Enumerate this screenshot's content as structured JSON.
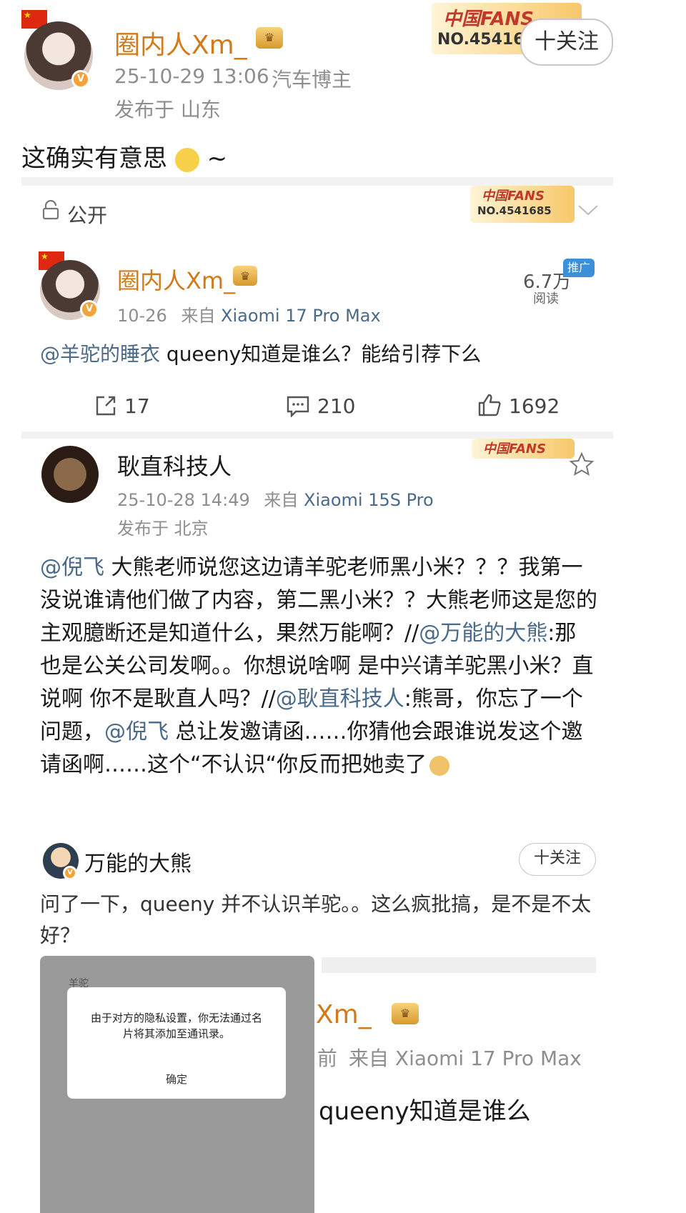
{
  "main_post": {
    "username": "圈内人Xm_",
    "meta": "25-10-29 13:06",
    "role": "汽车博主",
    "location": "发布于 山东",
    "text": "这确实有意思",
    "text_suffix": "~",
    "follow_label": "十关注",
    "fans_title": "中国FANS",
    "fans_no": "NO.454168"
  },
  "visibility": {
    "label": "公开",
    "fans_title": "中国FANS",
    "fans_no": "NO.4541685"
  },
  "quoted_post": {
    "username": "圈内人Xm_",
    "date": "10-26",
    "source_prefix": "来自",
    "source_device": "Xiaomi 17 Pro Max",
    "mention": "@羊驼的睡衣",
    "text": " queeny知道是谁么？能给引荐下么",
    "reads_value": "6.7万",
    "reads_label": "阅读",
    "promo_tag": "推广",
    "repost_count": "17",
    "comment_count": "210",
    "like_count": "1692"
  },
  "reply": {
    "username": "耿直科技人",
    "date": "25-10-28 14:49",
    "source_prefix": "来自",
    "source_device": "Xiaomi 15S Pro",
    "location": "发布于 北京",
    "fans_title": "中国FANS",
    "segments": [
      {
        "t": "@倪飞",
        "c": "mention"
      },
      {
        "t": " 大熊老师说您这边请羊驼老师黑小米？？？我第一没说谁请他们做了内容，第二黑小米？？大熊老师这是您的主观臆断还是知道什么，果然万能啊？//",
        "c": "text"
      },
      {
        "t": "@万能的大熊",
        "c": "mention"
      },
      {
        "t": ":那也是公关公司发啊。。你想说啥啊 是中兴请羊驼黑小米？直说啊 你不是耿直人吗？//",
        "c": "text"
      },
      {
        "t": "@耿直科技人",
        "c": "mention"
      },
      {
        "t": ":熊哥，你忘了一个问题，",
        "c": "text"
      },
      {
        "t": "@倪飞",
        "c": "mention"
      },
      {
        "t": " 总让发邀请函……你猜他会跟谁说发这个邀请函啊……这个“不认识“你反而把她卖了",
        "c": "text"
      }
    ]
  },
  "embedded": {
    "username": "万能的大熊",
    "follow_label": "十关注",
    "text": "问了一下，queeny 并不认识羊驼。。这么疯批搞，是不是不太好？",
    "dialog_top_label": "羊驼",
    "dialog_message": "由于对方的隐私设置，你无法通过名片将其添加至通讯录。",
    "dialog_confirm": "确定",
    "peek_name": "Xm_",
    "peek_prefix": "前",
    "peek_source": "来自 Xiaomi 17 Pro Max",
    "peek_text": "queeny知道是谁么"
  },
  "colors": {
    "accent_gold": "#d27a19",
    "mention_blue": "#4a6a8a",
    "promo_blue": "#3d8fd8"
  }
}
